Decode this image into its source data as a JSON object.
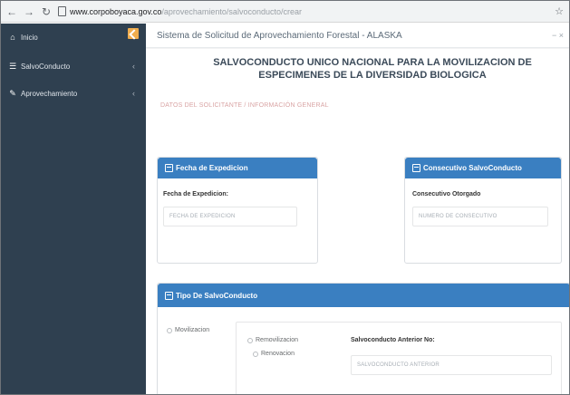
{
  "browser": {
    "back": "←",
    "forward": "→",
    "reload": "↻",
    "url_host": "www.corpoboyaca.gov.co",
    "url_path": "/aprovechamiento/salvoconducto/crear",
    "star": "☆"
  },
  "sidebar": {
    "items": [
      {
        "label": "Inicio",
        "icon": "home-icon",
        "glyph": "⌂"
      },
      {
        "label": "SalvoConducto",
        "icon": "list-icon",
        "glyph": "☰"
      },
      {
        "label": "Aprovechamiento",
        "icon": "leaf-icon",
        "glyph": "✎"
      }
    ],
    "chevron": "‹",
    "accent": "#f0ad4e"
  },
  "topbar": {
    "title": "Sistema de Solicitud de Aprovechamiento Forestal - ALASKA",
    "window_controls": "− ×"
  },
  "page": {
    "title": "SALVOCONDUCTO UNICO NACIONAL PARA LA MOVILIZACION DE ESPECIMENES DE LA DIVERSIDAD BIOLOGICA",
    "breadcrumb": "DATOS DEL SOLICITANTE  /  INFORMACIÓN GENERAL"
  },
  "panels": {
    "fecha": {
      "header": "Fecha de Expedicion",
      "label": "Fecha de Expedicion:",
      "placeholder": "FECHA DE EXPEDICION"
    },
    "consecutivo": {
      "header": "Consecutivo SalvoConducto",
      "label": "Consecutivo Otorgado",
      "placeholder": "NUMERO DE CONSECUTIVO"
    },
    "tipo": {
      "header": "Tipo De SalvoConducto",
      "options": [
        "Movilizacion",
        "Removilizacion",
        "Renovacion"
      ],
      "anterior_label": "Salvoconducto Anterior No:",
      "anterior_placeholder": "SALVOCONDUCTO ANTERIOR"
    }
  },
  "colors": {
    "sidebar_bg": "#2f4050",
    "panel_header": "#3a7fc1",
    "title_text": "#3b4a59"
  }
}
